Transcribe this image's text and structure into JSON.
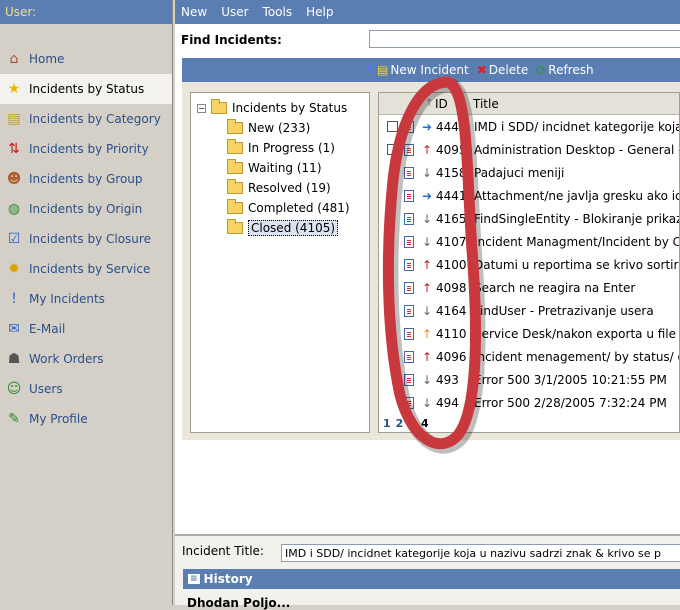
{
  "sidebar": {
    "header": "User:",
    "items": [
      {
        "label": "Home",
        "icon": "home-icon",
        "glyph": "⌂",
        "color": "#a0522d"
      },
      {
        "label": "Incidents by Status",
        "icon": "star-icon",
        "glyph": "★",
        "color": "#e8b800"
      },
      {
        "label": "Incidents by Category",
        "icon": "folders-icon",
        "glyph": "▤",
        "color": "#c09b2a"
      },
      {
        "label": "Incidents by Priority",
        "icon": "priority-arrows-icon",
        "glyph": "⇅",
        "color": "#c71b1b"
      },
      {
        "label": "Incidents by Group",
        "icon": "group-icon",
        "glyph": "☻",
        "color": "#b06030"
      },
      {
        "label": "Incidents by Origin",
        "icon": "globe-icon",
        "glyph": "◍",
        "color": "#2a8a2a"
      },
      {
        "label": "Incidents by Closure",
        "icon": "checkbox-icon",
        "glyph": "☑",
        "color": "#2a5fd0"
      },
      {
        "label": "Incidents by Service",
        "icon": "gear-icon",
        "glyph": "✹",
        "color": "#d8a000"
      },
      {
        "label": "My Incidents",
        "icon": "exclamation-icon",
        "glyph": "!",
        "color": "#2a5fd0"
      },
      {
        "label": "E-Mail",
        "icon": "envelope-icon",
        "glyph": "✉",
        "color": "#2a5fd0"
      },
      {
        "label": "Work Orders",
        "icon": "worker-icon",
        "glyph": "☗",
        "color": "#555"
      },
      {
        "label": "Users",
        "icon": "user-icon",
        "glyph": "☺",
        "color": "#2a8a2a"
      },
      {
        "label": "My Profile",
        "icon": "profile-icon",
        "glyph": "✎",
        "color": "#2a8a2a"
      }
    ]
  },
  "menu": [
    "New",
    "User",
    "Tools",
    "Help"
  ],
  "find": {
    "label": "Find Incidents:",
    "value": ""
  },
  "toolbar": {
    "new": "New Incident",
    "delete": "Delete",
    "refresh": "Refresh"
  },
  "tree": {
    "root": "Incidents by Status",
    "children": [
      "New (233)",
      "In Progress (1)",
      "Waiting (11)",
      "Resolved (19)",
      "Completed (481)",
      "Closed (4105)"
    ],
    "selected": 5
  },
  "grid": {
    "headers": {
      "id": "ID",
      "title": "Title"
    },
    "rows": [
      {
        "checkbox": true,
        "priority": "right",
        "id": "444",
        "title": "IMD i SDD/ incidnet kategorije koja"
      },
      {
        "checkbox": true,
        "priority": "up",
        "id": "4095",
        "title": "Administration Desktop - General - i"
      },
      {
        "checkbox": false,
        "priority": "down",
        "id": "4158",
        "title": "Padajuci meniji"
      },
      {
        "checkbox": false,
        "priority": "right",
        "id": "4441",
        "title": "Attachment/ne javlja gresku ako ide"
      },
      {
        "checkbox": false,
        "priority": "down",
        "id": "4165",
        "title": "FindSingleEntity - Blokiranje prikaza"
      },
      {
        "checkbox": false,
        "priority": "down",
        "id": "4107",
        "title": "Incident Managment/Incident by Clo"
      },
      {
        "checkbox": false,
        "priority": "up",
        "id": "4100",
        "title": "Datumi u reportima se krivo sortiraj"
      },
      {
        "checkbox": false,
        "priority": "up",
        "id": "4098",
        "title": "Search ne reagira na Enter"
      },
      {
        "checkbox": false,
        "priority": "down",
        "id": "4164",
        "title": "FindUser - Pretrazivanje usera"
      },
      {
        "checkbox": false,
        "priority": "upo",
        "id": "4110",
        "title": "Service Desk/nakon exporta u file n"
      },
      {
        "checkbox": false,
        "priority": "up",
        "id": "4096",
        "title": "incident menagement/ by status/ otv"
      },
      {
        "checkbox": false,
        "priority": "down",
        "id": "493",
        "title": "Error 500 3/1/2005 10:21:55 PM"
      },
      {
        "checkbox": false,
        "priority": "down",
        "id": "494",
        "title": "Error 500 2/28/2005 7:32:24 PM"
      }
    ],
    "pages": [
      "1",
      "2",
      "3",
      "4"
    ]
  },
  "detail": {
    "title_label": "Incident Title:",
    "title_value": "IMD i SDD/ incidnet kategorije koja u nazivu sadrzi znak & krivo se p",
    "history": "History",
    "body": "Dhodan Poljo..."
  }
}
